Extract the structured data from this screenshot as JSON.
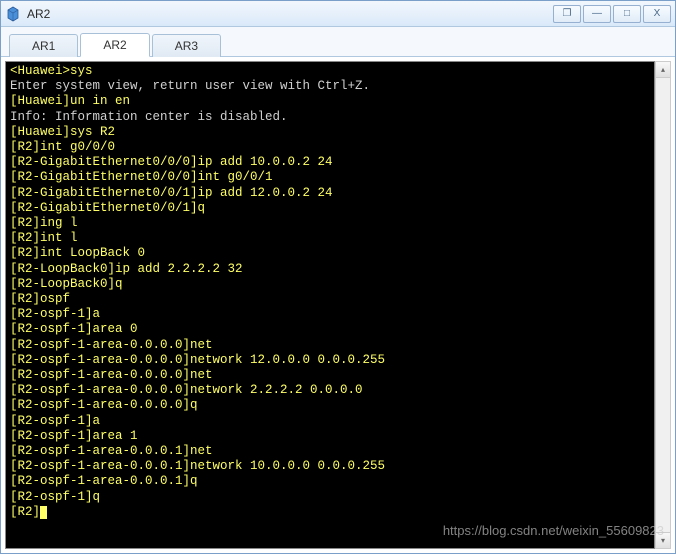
{
  "window": {
    "title": "AR2"
  },
  "tabs": [
    {
      "label": "AR1",
      "active": false
    },
    {
      "label": "AR2",
      "active": true
    },
    {
      "label": "AR3",
      "active": false
    }
  ],
  "controls": {
    "popout": "❐",
    "minimize": "—",
    "maximize": "□",
    "close": "X"
  },
  "terminal": {
    "lines": [
      {
        "text": "<Huawei>sys",
        "cls": ""
      },
      {
        "text": "Enter system view, return user view with Ctrl+Z.",
        "cls": "white"
      },
      {
        "text": "[Huawei]un in en",
        "cls": ""
      },
      {
        "text": "Info: Information center is disabled.",
        "cls": "white"
      },
      {
        "text": "[Huawei]sys R2",
        "cls": ""
      },
      {
        "text": "[R2]int g0/0/0",
        "cls": ""
      },
      {
        "text": "[R2-GigabitEthernet0/0/0]ip add 10.0.0.2 24",
        "cls": ""
      },
      {
        "text": "[R2-GigabitEthernet0/0/0]int g0/0/1",
        "cls": ""
      },
      {
        "text": "[R2-GigabitEthernet0/0/1]ip add 12.0.0.2 24",
        "cls": ""
      },
      {
        "text": "[R2-GigabitEthernet0/0/1]q",
        "cls": ""
      },
      {
        "text": "[R2]ing l",
        "cls": ""
      },
      {
        "text": "[R2]int l",
        "cls": ""
      },
      {
        "text": "[R2]int LoopBack 0",
        "cls": ""
      },
      {
        "text": "[R2-LoopBack0]ip add 2.2.2.2 32",
        "cls": ""
      },
      {
        "text": "[R2-LoopBack0]q",
        "cls": ""
      },
      {
        "text": "[R2]ospf",
        "cls": ""
      },
      {
        "text": "[R2-ospf-1]a",
        "cls": ""
      },
      {
        "text": "[R2-ospf-1]area 0",
        "cls": ""
      },
      {
        "text": "[R2-ospf-1-area-0.0.0.0]net",
        "cls": ""
      },
      {
        "text": "[R2-ospf-1-area-0.0.0.0]network 12.0.0.0 0.0.0.255",
        "cls": ""
      },
      {
        "text": "[R2-ospf-1-area-0.0.0.0]net",
        "cls": ""
      },
      {
        "text": "[R2-ospf-1-area-0.0.0.0]network 2.2.2.2 0.0.0.0",
        "cls": ""
      },
      {
        "text": "[R2-ospf-1-area-0.0.0.0]q",
        "cls": ""
      },
      {
        "text": "[R2-ospf-1]a",
        "cls": ""
      },
      {
        "text": "[R2-ospf-1]area 1",
        "cls": ""
      },
      {
        "text": "[R2-ospf-1-area-0.0.0.1]net",
        "cls": ""
      },
      {
        "text": "[R2-ospf-1-area-0.0.0.1]network 10.0.0.0 0.0.0.255",
        "cls": ""
      },
      {
        "text": "[R2-ospf-1-area-0.0.0.1]q",
        "cls": ""
      },
      {
        "text": "[R2-ospf-1]q",
        "cls": ""
      }
    ],
    "prompt_last": "[R2]"
  },
  "watermark": "https://blog.csdn.net/weixin_55609823"
}
